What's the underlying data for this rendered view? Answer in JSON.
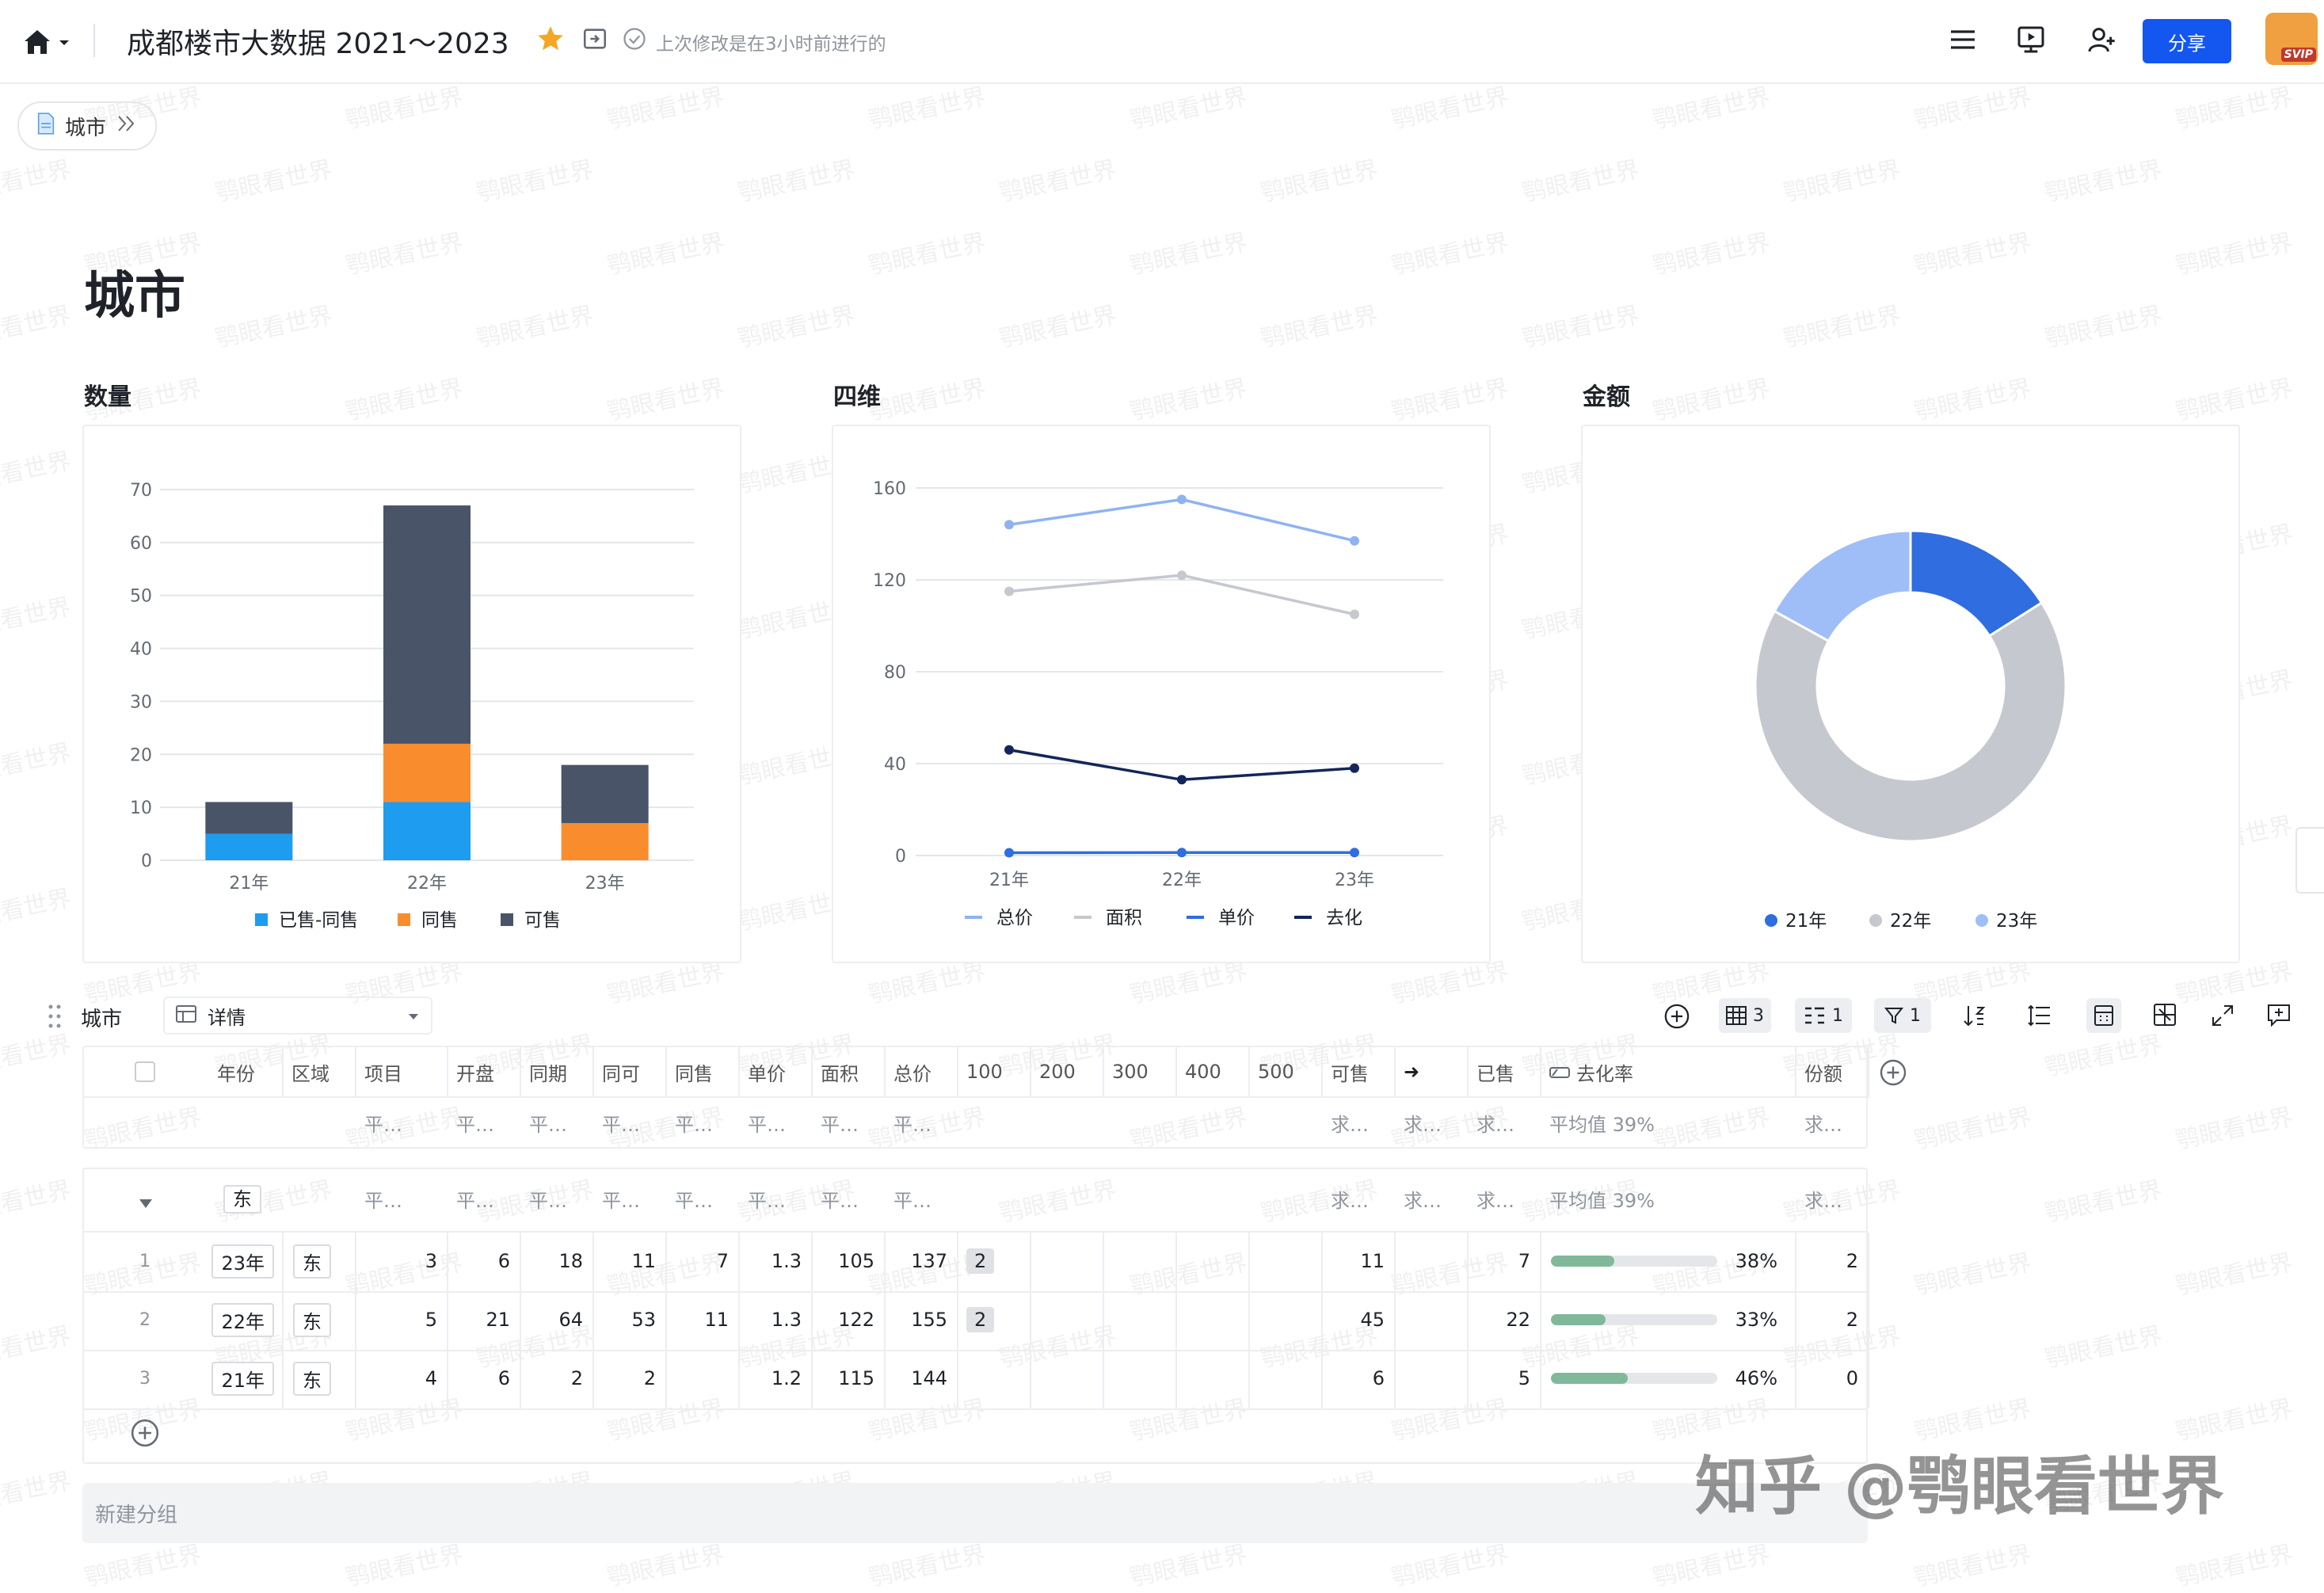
{
  "header": {
    "title": "成都楼市大数据 2021～2023",
    "last_modified": "上次修改是在3小时前进行的",
    "share_label": "分享",
    "avatar_badge": "SVIP"
  },
  "breadcrumb": {
    "label": "城市"
  },
  "page": {
    "title": "城市"
  },
  "charts_titles": {
    "quantity": "数量",
    "four_dim": "四维",
    "amount": "金额"
  },
  "chart_data": [
    {
      "type": "bar",
      "title": "数量",
      "stacked": true,
      "categories": [
        "21年",
        "22年",
        "23年"
      ],
      "series": [
        {
          "name": "已售-同售",
          "color": "#1e9cf0",
          "values": [
            5,
            11,
            0
          ]
        },
        {
          "name": "同售",
          "color": "#f98d2e",
          "values": [
            0,
            11,
            7
          ]
        },
        {
          "name": "可售",
          "color": "#4a5468",
          "values": [
            6,
            45,
            11
          ]
        }
      ],
      "y_ticks": [
        "0",
        "10",
        "20",
        "30",
        "40",
        "50",
        "60",
        "70"
      ],
      "ylim": [
        0,
        70
      ],
      "legend_position": "bottom",
      "grid": true
    },
    {
      "type": "line",
      "title": "四维",
      "categories": [
        "21年",
        "22年",
        "23年"
      ],
      "series": [
        {
          "name": "总价",
          "color": "#8fb3f0",
          "values": [
            144,
            155,
            137
          ]
        },
        {
          "name": "面积",
          "color": "#c5c8ce",
          "values": [
            115,
            122,
            105
          ]
        },
        {
          "name": "单价",
          "color": "#2f6de0",
          "values": [
            1.2,
            1.3,
            1.3
          ]
        },
        {
          "name": "去化",
          "color": "#13265a",
          "values": [
            46,
            33,
            38
          ]
        }
      ],
      "y_ticks": [
        "0",
        "40",
        "80",
        "120",
        "160"
      ],
      "ylim": [
        0,
        160
      ],
      "legend_position": "bottom",
      "grid": true
    },
    {
      "type": "pie",
      "title": "金额",
      "donut": true,
      "labels": [
        "21年",
        "22年",
        "23年"
      ],
      "colors": [
        "#2f6de0",
        "#c5c8ce",
        "#9fbef7"
      ],
      "values": [
        0.16,
        0.67,
        0.17
      ],
      "legend_position": "bottom"
    }
  ],
  "view": {
    "table_name": "城市",
    "view_name": "详情",
    "toolbar": {
      "fields_count": "3",
      "group_count": "1",
      "filter_count": "1"
    }
  },
  "table": {
    "columns": [
      "年份",
      "区域",
      "项目",
      "开盘",
      "同期",
      "同可",
      "同售",
      "单价",
      "面积",
      "总价",
      "100",
      "200",
      "300",
      "400",
      "500",
      "可售",
      "➜",
      "已售",
      "去化率",
      "份额"
    ],
    "summary_row": [
      "平…",
      "平…",
      "平…",
      "平…",
      "平…",
      "平…",
      "平…",
      "平…",
      "求…",
      "求…",
      "求…",
      "平均值 39%",
      "求…"
    ],
    "group": {
      "label": "东"
    },
    "rows": [
      {
        "index": "1",
        "year": "23年",
        "region": "东",
        "项目": "3",
        "开盘": "6",
        "同期": "18",
        "同可": "11",
        "同售": "7",
        "单价": "1.3",
        "面积": "105",
        "总价": "137",
        "c100": "2",
        "可售": "11",
        "已售": "7",
        "去化率": "38%",
        "rate": 0.38,
        "份额": "2"
      },
      {
        "index": "2",
        "year": "22年",
        "region": "东",
        "项目": "5",
        "开盘": "21",
        "同期": "64",
        "同可": "53",
        "同售": "11",
        "单价": "1.3",
        "面积": "122",
        "总价": "155",
        "c100": "2",
        "可售": "45",
        "已售": "22",
        "去化率": "33%",
        "rate": 0.33,
        "份额": "2"
      },
      {
        "index": "3",
        "year": "21年",
        "region": "东",
        "项目": "4",
        "开盘": "6",
        "同期": "2",
        "同可": "2",
        "同售": "",
        "单价": "1.2",
        "面积": "115",
        "总价": "144",
        "c100": "",
        "可售": "6",
        "已售": "5",
        "去化率": "46%",
        "rate": 0.46,
        "份额": "0"
      }
    ],
    "new_group_label": "新建分组"
  },
  "watermark": {
    "text": "鹗眼看世界",
    "signature": "知乎 @鹗眼看世界"
  }
}
